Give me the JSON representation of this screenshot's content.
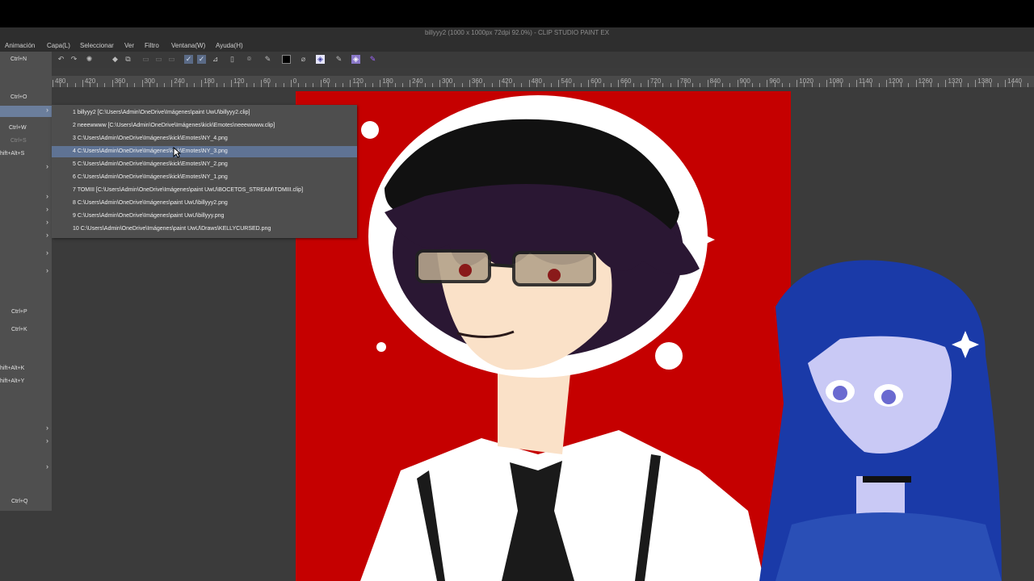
{
  "window": {
    "title": "billyyy2 (1000 x 1000px 72dpi 92.0%) - CLIP STUDIO PAINT EX"
  },
  "menubar": {
    "items": [
      "Animación",
      "Capa(L)",
      "Seleccionar",
      "Ver",
      "Filtro",
      "Ventana(W)",
      "Ayuda(H)"
    ]
  },
  "file_menu": {
    "shortcuts": {
      "new": "Ctrl+N",
      "open": "Ctrl+O",
      "close": "Ctrl+W",
      "save": "Ctrl+S",
      "save_as": "hift+Alt+S",
      "print": "Ctrl+P",
      "print_setup": "Ctrl+K",
      "export_a": "hift+Alt+K",
      "export_b": "hift+Alt+Y",
      "quit": "Ctrl+Q"
    }
  },
  "recent_files": [
    "1 billyyy2 [C:\\Users\\Admin\\OneDrive\\Imágenes\\paint UwU\\billyyy2.clip]",
    "2 neeewwww [C:\\Users\\Admin\\OneDrive\\Imágenes\\kick\\Emotes\\neeewwww.clip]",
    "3 C:\\Users\\Admin\\OneDrive\\Imágenes\\kick\\Emotes\\NY_4.png",
    "4 C:\\Users\\Admin\\OneDrive\\Imágenes\\kick\\Emotes\\NY_3.png",
    "5 C:\\Users\\Admin\\OneDrive\\Imágenes\\kick\\Emotes\\NY_2.png",
    "6 C:\\Users\\Admin\\OneDrive\\Imágenes\\kick\\Emotes\\NY_1.png",
    "7 TOMIII [C:\\Users\\Admin\\OneDrive\\Imágenes\\paint UwU\\BOCETOS_STREAM\\TOMIII.clip]",
    "8 C:\\Users\\Admin\\OneDrive\\Imágenes\\paint UwU\\billyyy2.png",
    "9 C:\\Users\\Admin\\OneDrive\\Imágenes\\paint UwU\\billyyy.png",
    "10 C:\\Users\\Admin\\OneDrive\\Imágenes\\paint UwU\\Draws\\KELLYCURSED.png"
  ],
  "ruler": {
    "labels": [
      "480",
      "420",
      "360",
      "300",
      "240",
      "180",
      "120",
      "60",
      "0",
      "60",
      "120",
      "180",
      "240",
      "300",
      "360",
      "420",
      "480",
      "540",
      "600",
      "660",
      "720",
      "780",
      "840",
      "900",
      "960",
      "1020",
      "1080",
      "1140",
      "1200",
      "1260",
      "1320",
      "1380",
      "1440"
    ]
  },
  "colors": {
    "canvas_bg": "#c50000",
    "menu_highlight": "#5f7394"
  },
  "icons": [
    "undo-icon",
    "redo-icon",
    "loading-icon",
    "fill-icon",
    "transform-icon",
    "hide-icon",
    "clear-icon",
    "select-icon",
    "pen-icon",
    "ruler-icon",
    "eyedropper-icon",
    "brush-icon",
    "color-swatch-icon",
    "eraser-icon",
    "rotate-icon",
    "dropper-icon",
    "layer-icon",
    "settings-icon"
  ]
}
